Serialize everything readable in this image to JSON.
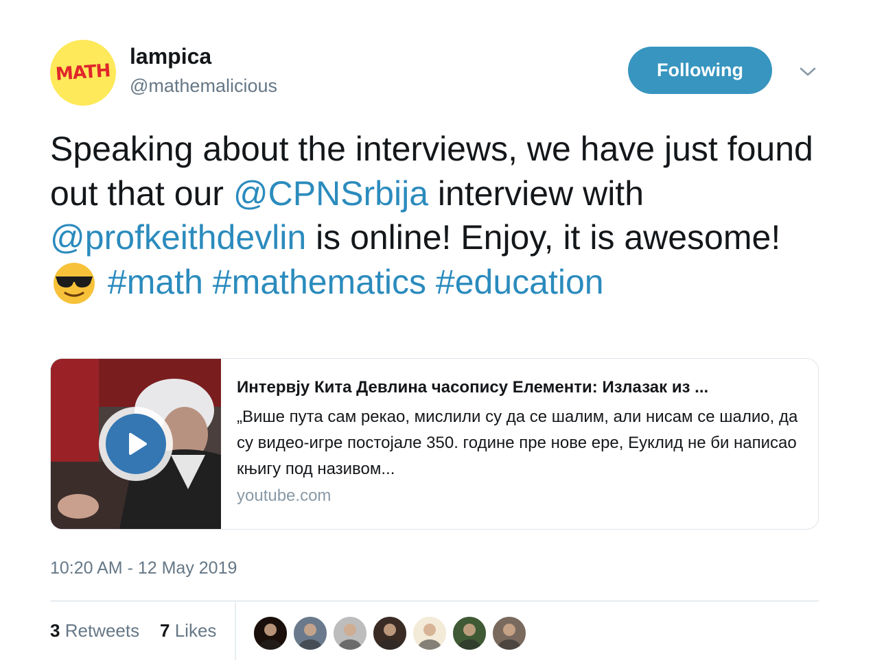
{
  "author": {
    "avatar_text": "MATH",
    "name": "lampica",
    "handle": "@mathemalicious"
  },
  "follow_button": {
    "label": "Following"
  },
  "menu": {
    "icon": "chevron-down-icon"
  },
  "tweet": {
    "segments": [
      {
        "type": "text",
        "value": "Speaking about the interviews, we have just found out that our "
      },
      {
        "type": "mention",
        "value": "@CPNSrbija"
      },
      {
        "type": "text",
        "value": " interview with "
      },
      {
        "type": "mention",
        "value": "@profkeithdevlin"
      },
      {
        "type": "text",
        "value": " is online! Enjoy, it is awesome! "
      },
      {
        "type": "emoji",
        "value": "smiling-face-with-sunglasses"
      },
      {
        "type": "text",
        "value": " "
      },
      {
        "type": "hashtag",
        "value": "#math"
      },
      {
        "type": "text",
        "value": " "
      },
      {
        "type": "hashtag",
        "value": "#mathematics"
      },
      {
        "type": "text",
        "value": " "
      },
      {
        "type": "hashtag",
        "value": "#education"
      }
    ]
  },
  "card": {
    "title": "Интервју Кита Девлина часопису Елементи: Излазак из ...",
    "description": "„Више пута сам рекао, мислили су да се шалим, али нисам се шалио, да су видео-игре постојале 350. године пре нове ере, Еуклид не би написао књигу под називом...",
    "domain": "youtube.com",
    "play_icon": "play-icon"
  },
  "timestamp": "10:20 AM - 12 May 2019",
  "stats": {
    "retweets_count": "3",
    "retweets_label": "Retweets",
    "likes_count": "7",
    "likes_label": "Likes"
  },
  "likers": [
    {
      "name": "liker-avatar-1",
      "color": "#1a0f0a"
    },
    {
      "name": "liker-avatar-2",
      "color": "#6a7a8c"
    },
    {
      "name": "liker-avatar-3",
      "color": "#bdbdbd"
    },
    {
      "name": "liker-avatar-4",
      "color": "#3a2b24"
    },
    {
      "name": "liker-avatar-5",
      "color": "#f3ead8"
    },
    {
      "name": "liker-avatar-6",
      "color": "#3f5a34"
    },
    {
      "name": "liker-avatar-7",
      "color": "#7a6a5e"
    }
  ],
  "colors": {
    "link": "#2b8bbd",
    "button": "#3795bf",
    "secondary_text": "#657786"
  }
}
